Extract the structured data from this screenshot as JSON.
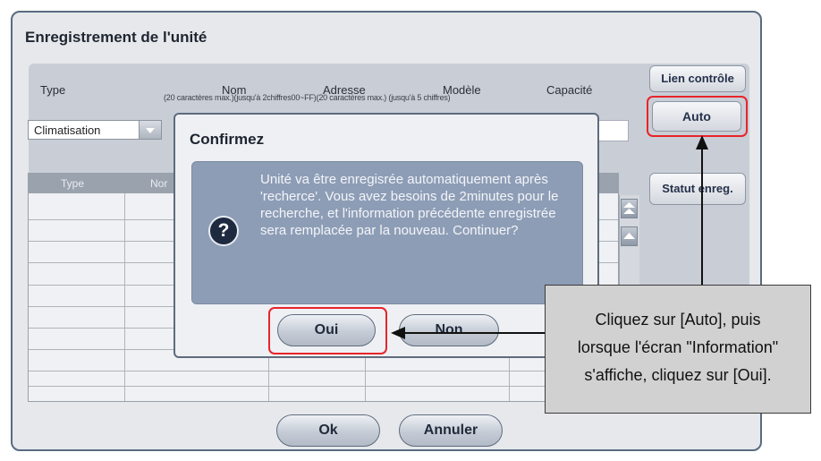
{
  "window": {
    "title": "Enregistrement de l'unité"
  },
  "columns_header": {
    "type": "Type",
    "nom": "Nom",
    "adresse": "Adresse",
    "modele": "Modèle",
    "capacite": "Capacité",
    "sub_labels": "(20 caractères max.)(jusqu'à 2chiffres00~FF)(20 caractères max.)   (jusqu'à 5 chiffres)"
  },
  "type_select": {
    "value": "Climatisation"
  },
  "side_buttons": {
    "lien_controle": "Lien contrôle",
    "auto": "Auto",
    "statut_enreg": "Statut enreg."
  },
  "table": {
    "headers": [
      "Type",
      "Nor"
    ]
  },
  "dialog": {
    "title": "Confirmez",
    "message": "Unité va être enregisrée automatiquement après 'recherce'. Vous avez besoins de 2minutes pour le recherche, et l'information précédente enregistrée sera remplacée par la nouveau. Continuer?",
    "oui": "Oui",
    "non": "Non"
  },
  "footer": {
    "ok": "Ok",
    "annuler": "Annuler"
  },
  "callout": {
    "lines": [
      "Cliquez sur [Auto], puis",
      "lorsque l'écran \"Information\"",
      "s'affiche, cliquez sur [Oui]."
    ]
  },
  "colors": {
    "highlight": "#e8242a",
    "dialog_message_bg": "#8e9db6",
    "window_border": "#596b80"
  }
}
